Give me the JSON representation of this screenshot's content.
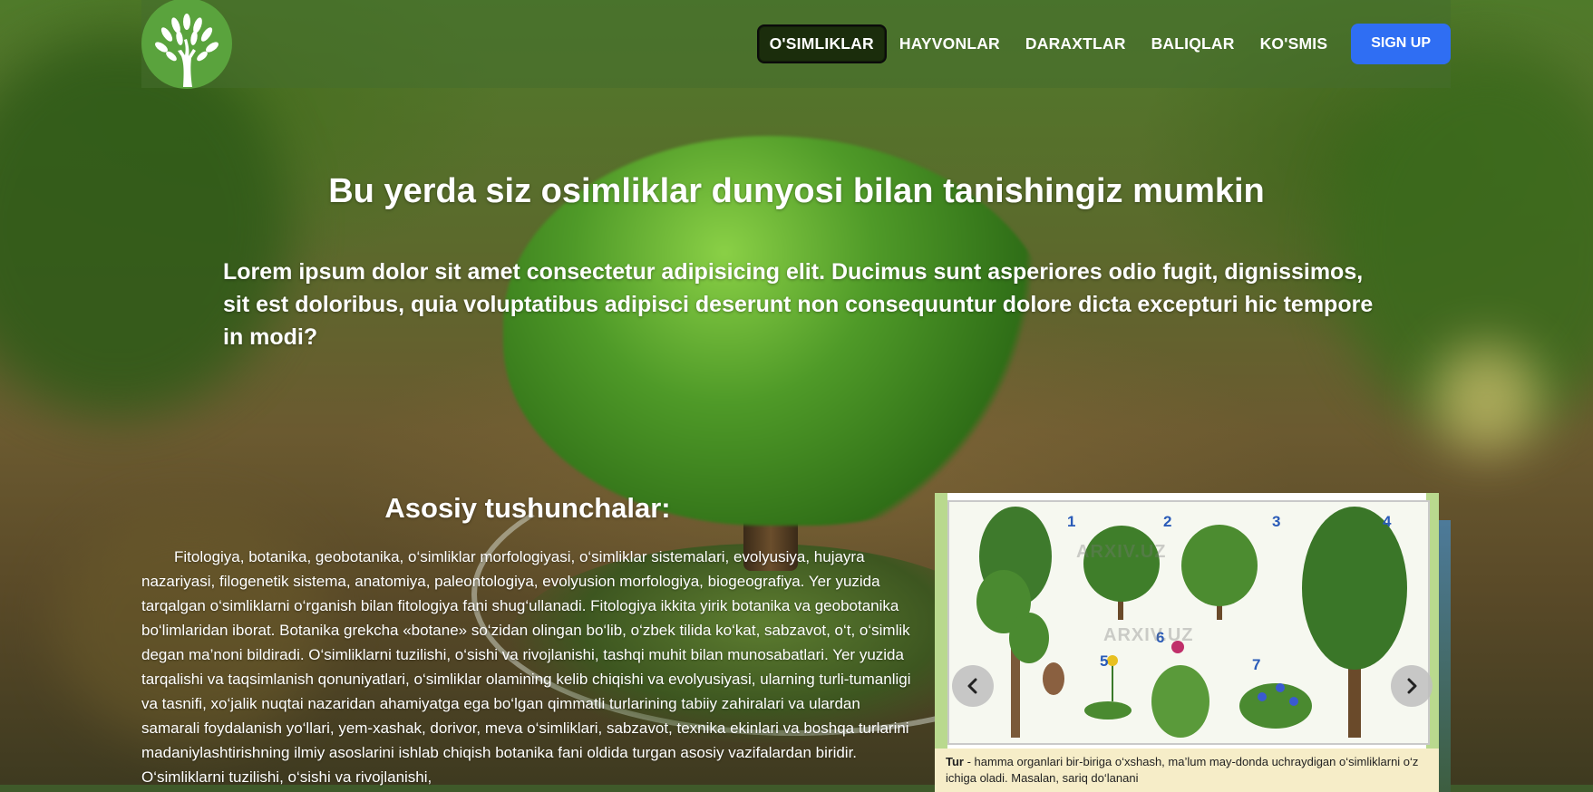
{
  "nav": {
    "items": [
      {
        "label": "O'SIMLIKLAR",
        "active": true
      },
      {
        "label": "HAYVONLAR",
        "active": false
      },
      {
        "label": "DARAXTLAR",
        "active": false
      },
      {
        "label": "BALIQLAR",
        "active": false
      },
      {
        "label": "KO'SMIS",
        "active": false
      }
    ],
    "signup_label": "SIGN UP"
  },
  "hero": {
    "title": "Bu yerda siz osimliklar dunyosi bilan tanishingiz mumkin",
    "subtitle": "Lorem ipsum dolor sit amet consectetur adipisicing elit. Ducimus sunt asperiores odio fugit, dignissimos, sit est doloribus, quia voluptatibus adipisci deserunt non consequuntur dolore dicta excepturi hic tempore in modi?"
  },
  "content": {
    "heading": "Asosiy tushunchalar:",
    "paragraph": "Fitologiya, botanika, geobotanika, o‘simliklar morfologiyasi, o‘simliklar sistemalari, evolyusiya, hujayra nazariyasi, filogenetik sistema, anatomiya, paleontologiya, evolyusion morfologiya, biogeografiya. Yer yuzida tarqalgan o‘simliklarni o‘rganish bilan fitologiya fani shug‘ullanadi. Fitologiya ikkita yirik botanika va geobotanika bo‘limlaridan iborat. Botanika grekcha «botane» so‘zidan olingan bo‘lib, o‘zbek tilida ko‘kat, sabzavot, o‘t, o‘simlik degan ma’noni bildiradi. O‘simliklarni tuzilishi, o‘sishi va rivojlanishi, tashqi muhit bilan munosabatlari. Yer yuzida tarqalishi va taqsimlanish qonuniyatlari, o‘simliklar olamining kelib chiqishi va evolyusiyasi, ularning turli-tumanligi va tasnifi, xo‘jalik nuqtai nazaridan ahamiyatga ega bo‘lgan qimmatli turlarining tabiiy zahiralari va ulardan samarali foydalanish yo‘llari, yem-xashak, dorivor, meva o‘simliklari, sabzavot, texnika ekinlari va boshqa turlarini madaniylashtirishning ilmiy asoslarini ishlab chiqish botanika fani oldida turgan asosiy vazifalardan biridir. O‘simliklarni tuzilishi, o‘sishi va rivojlanishi,"
  },
  "carousel": {
    "numbers": [
      "1",
      "2",
      "3",
      "4",
      "5",
      "6",
      "7"
    ],
    "watermark": "ARXIV.UZ",
    "caption_term": "Tur",
    "caption_text": " - hamma organlari bir-biriga o‘xshash, ma’lum may-donda uchraydigan o‘simliklarni o‘z ichiga oladi. Masalan, sariq do‘lanani"
  },
  "colors": {
    "signup": "#2f6ef3",
    "nav_active_bg": "#1b2d0c",
    "logo_green": "#5aa33d"
  }
}
